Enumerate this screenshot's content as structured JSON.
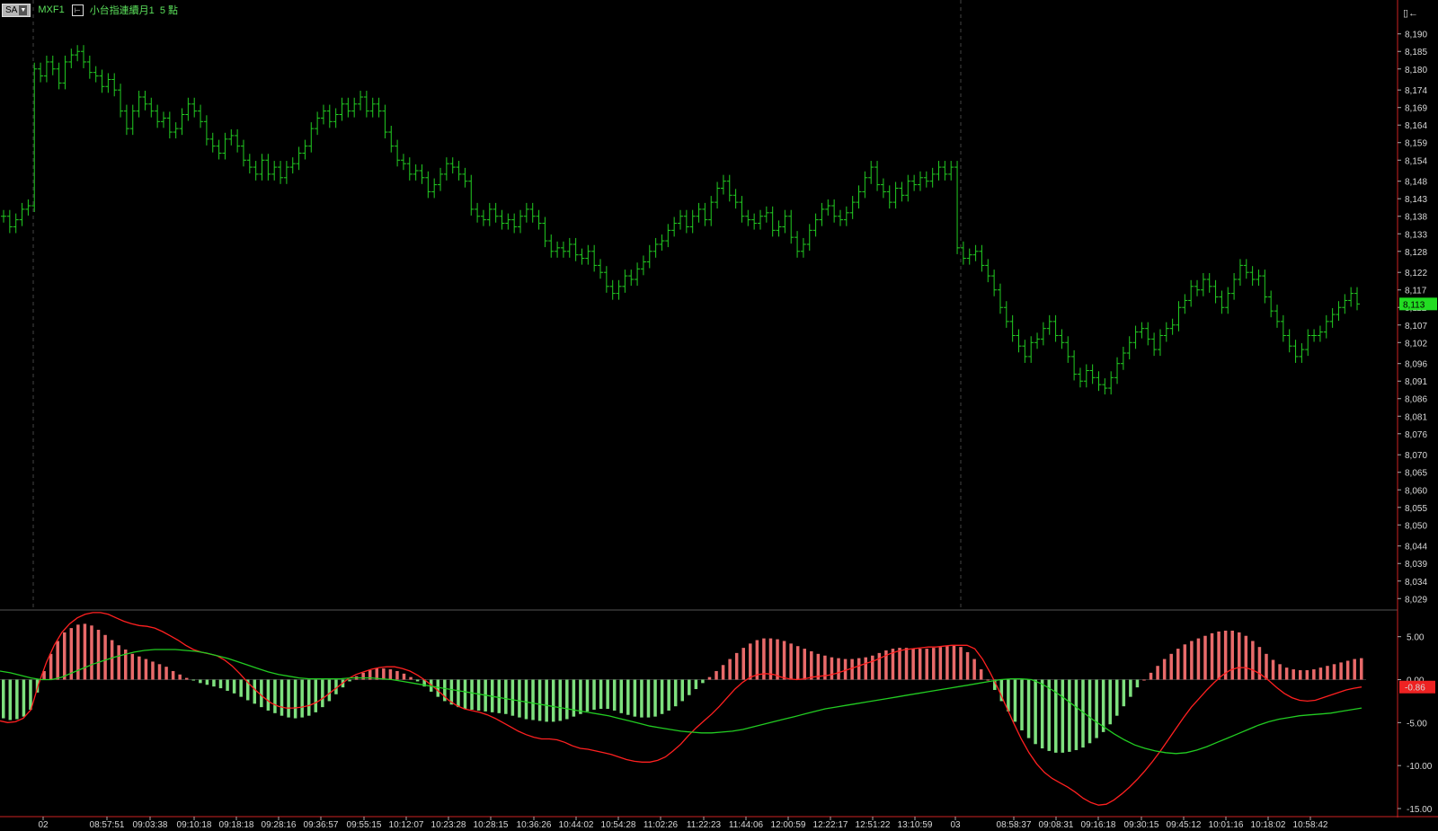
{
  "header": {
    "mode_label": "SA",
    "symbol": "MXF1",
    "chart_title": "小台指連續月1",
    "interval": "5 點"
  },
  "colors": {
    "bars": "#22cc22",
    "hist_up": "#e86a6a",
    "hist_down": "#7ee07e",
    "dif_line": "#ff2020",
    "signal_line": "#22cc22",
    "current_price_bg": "#22dd22",
    "current_osc_bg": "#ee2222",
    "panel_border": "#cc2222"
  },
  "icons": {
    "mode_dropdown": "chevron-down-icon",
    "toggle": "expand-icon",
    "pin": "pin-icon"
  },
  "chart_data": [
    {
      "type": "ohlc",
      "name": "price",
      "current_value": "8,113",
      "y_ticks": [
        "8,190",
        "8,185",
        "8,180",
        "8,174",
        "8,169",
        "8,164",
        "8,159",
        "8,154",
        "8,148",
        "8,143",
        "8,138",
        "8,133",
        "8,128",
        "8,122",
        "8,117",
        "8,112",
        "8,107",
        "8,102",
        "8,096",
        "8,091",
        "8,086",
        "8,081",
        "8,076",
        "8,070",
        "8,065",
        "8,060",
        "8,055",
        "8,050",
        "8,044",
        "8,039",
        "8,034",
        "8,029"
      ],
      "ylim": [
        8026,
        8193
      ],
      "close": [
        8138,
        8135,
        8137,
        8140,
        8141,
        8180,
        8178,
        8182,
        8180,
        8176,
        8182,
        8184,
        8185,
        8182,
        8179,
        8178,
        8175,
        8177,
        8174,
        8168,
        8163,
        8168,
        8172,
        8170,
        8168,
        8165,
        8166,
        8162,
        8163,
        8167,
        8170,
        8168,
        8165,
        8160,
        8158,
        8156,
        8160,
        8161,
        8158,
        8154,
        8152,
        8150,
        8154,
        8150,
        8152,
        8149,
        8152,
        8153,
        8156,
        8158,
        8163,
        8166,
        8168,
        8165,
        8167,
        8170,
        8168,
        8170,
        8172,
        8168,
        8170,
        8168,
        8162,
        8158,
        8154,
        8153,
        8150,
        8151,
        8149,
        8145,
        8147,
        8150,
        8153,
        8152,
        8150,
        8148,
        8140,
        8138,
        8137,
        8140,
        8138,
        8136,
        8137,
        8135,
        8138,
        8140,
        8138,
        8136,
        8131,
        8128,
        8129,
        8128,
        8130,
        8127,
        8126,
        8128,
        8124,
        8122,
        8118,
        8116,
        8118,
        8121,
        8120,
        8123,
        8125,
        8128,
        8130,
        8131,
        8134,
        8136,
        8138,
        8135,
        8138,
        8140,
        8137,
        8142,
        8146,
        8148,
        8144,
        8142,
        8138,
        8137,
        8136,
        8138,
        8139,
        8134,
        8135,
        8138,
        8132,
        8128,
        8130,
        8134,
        8137,
        8140,
        8141,
        8138,
        8137,
        8139,
        8142,
        8145,
        8149,
        8152,
        8147,
        8145,
        8142,
        8146,
        8144,
        8148,
        8147,
        8149,
        8148,
        8150,
        8152,
        8150,
        8152,
        8129,
        8126,
        8127,
        8128,
        8124,
        8121,
        8117,
        8112,
        8108,
        8104,
        8101,
        8098,
        8102,
        8103,
        8106,
        8108,
        8104,
        8102,
        8098,
        8093,
        8091,
        8094,
        8092,
        8090,
        8089,
        8092,
        8096,
        8099,
        8102,
        8105,
        8106,
        8103,
        8100,
        8104,
        8106,
        8107,
        8112,
        8114,
        8118,
        8117,
        8120,
        8118,
        8115,
        8112,
        8116,
        8120,
        8124,
        8122,
        8120,
        8121,
        8115,
        8111,
        8108,
        8104,
        8101,
        8098,
        8100,
        8104,
        8104,
        8105,
        8108,
        8110,
        8112,
        8114,
        8116,
        8113
      ]
    },
    {
      "type": "macd",
      "name": "oscillator",
      "current_value": "-0.86",
      "y_ticks": [
        "5.00",
        "0.00",
        "-5.00",
        "-10.00",
        "-15.00"
      ],
      "ylim": [
        -15,
        8
      ],
      "histogram": [
        -4.5,
        -4.7,
        -4.6,
        -4.3,
        -3.5,
        -1.5,
        1.0,
        3.0,
        4.5,
        5.5,
        6.0,
        6.4,
        6.5,
        6.3,
        5.8,
        5.2,
        4.6,
        4.0,
        3.5,
        3.0,
        2.7,
        2.4,
        2.1,
        1.8,
        1.5,
        1.0,
        0.6,
        0.2,
        -0.1,
        -0.4,
        -0.6,
        -0.8,
        -1.0,
        -1.3,
        -1.6,
        -2.0,
        -2.4,
        -2.8,
        -3.2,
        -3.6,
        -3.9,
        -4.2,
        -4.4,
        -4.5,
        -4.4,
        -4.2,
        -3.8,
        -3.2,
        -2.5,
        -1.7,
        -0.9,
        -0.2,
        0.4,
        0.8,
        1.1,
        1.3,
        1.3,
        1.2,
        1.0,
        0.7,
        0.3,
        -0.2,
        -0.8,
        -1.4,
        -2.0,
        -2.5,
        -2.9,
        -3.2,
        -3.4,
        -3.5,
        -3.6,
        -3.7,
        -3.8,
        -3.9,
        -4.0,
        -4.2,
        -4.4,
        -4.6,
        -4.7,
        -4.8,
        -4.9,
        -4.9,
        -4.8,
        -4.6,
        -4.3,
        -4.0,
        -3.7,
        -3.5,
        -3.4,
        -3.4,
        -3.6,
        -3.9,
        -4.1,
        -4.3,
        -4.4,
        -4.4,
        -4.3,
        -4.0,
        -3.6,
        -3.1,
        -2.5,
        -1.8,
        -1.1,
        -0.4,
        0.3,
        1.0,
        1.7,
        2.4,
        3.1,
        3.7,
        4.2,
        4.6,
        4.8,
        4.8,
        4.7,
        4.5,
        4.2,
        3.9,
        3.6,
        3.3,
        3.0,
        2.8,
        2.6,
        2.5,
        2.4,
        2.4,
        2.5,
        2.6,
        2.8,
        3.1,
        3.4,
        3.6,
        3.7,
        3.7,
        3.6,
        3.6,
        3.6,
        3.7,
        3.8,
        3.9,
        4.0,
        3.8,
        3.2,
        2.4,
        1.2,
        0.0,
        -1.2,
        -2.5,
        -3.7,
        -4.9,
        -5.9,
        -6.8,
        -7.5,
        -8.0,
        -8.3,
        -8.5,
        -8.5,
        -8.4,
        -8.2,
        -7.9,
        -7.4,
        -6.8,
        -6.1,
        -5.2,
        -4.2,
        -3.1,
        -2.0,
        -0.9,
        0.0,
        0.8,
        1.6,
        2.4,
        3.0,
        3.6,
        4.1,
        4.5,
        4.8,
        5.1,
        5.4,
        5.6,
        5.7,
        5.7,
        5.5,
        5.1,
        4.5,
        3.8,
        3.0,
        2.3,
        1.8,
        1.4,
        1.2,
        1.1,
        1.1,
        1.2,
        1.4,
        1.6,
        1.8,
        2.0,
        2.2,
        2.4,
        2.5
      ],
      "dif": [
        -4.8,
        -5.0,
        -4.9,
        -4.5,
        -3.5,
        -0.5,
        2.0,
        4.0,
        5.5,
        6.5,
        7.2,
        7.6,
        7.8,
        7.8,
        7.6,
        7.2,
        6.8,
        6.5,
        6.3,
        6.2,
        6.0,
        5.6,
        5.1,
        4.6,
        4.0,
        3.5,
        3.2,
        3.0,
        2.8,
        2.3,
        1.6,
        0.7,
        -0.3,
        -1.2,
        -2.0,
        -2.7,
        -3.1,
        -3.3,
        -3.3,
        -3.2,
        -3.0,
        -2.6,
        -2.0,
        -1.3,
        -0.6,
        0.1,
        0.6,
        0.9,
        1.2,
        1.4,
        1.5,
        1.5,
        1.3,
        1.0,
        0.5,
        -0.1,
        -0.8,
        -1.6,
        -2.4,
        -3.0,
        -3.4,
        -3.6,
        -3.8,
        -4.1,
        -4.5,
        -5.0,
        -5.5,
        -6.0,
        -6.4,
        -6.7,
        -6.9,
        -6.9,
        -7.0,
        -7.3,
        -7.7,
        -8.0,
        -8.1,
        -8.3,
        -8.5,
        -8.7,
        -9.0,
        -9.3,
        -9.5,
        -9.6,
        -9.6,
        -9.4,
        -9.0,
        -8.3,
        -7.5,
        -6.5,
        -5.6,
        -4.8,
        -4.0,
        -3.1,
        -2.1,
        -1.1,
        -0.3,
        0.3,
        0.6,
        0.7,
        0.6,
        0.3,
        0.1,
        0.0,
        0.1,
        0.3,
        0.4,
        0.5,
        0.7,
        1.0,
        1.3,
        1.6,
        1.9,
        2.2,
        2.6,
        3.0,
        3.3,
        3.5,
        3.6,
        3.7,
        3.8,
        3.8,
        3.9,
        4.0,
        4.0,
        4.0,
        3.6,
        2.4,
        0.8,
        -1.0,
        -3.0,
        -5.0,
        -6.9,
        -8.5,
        -9.8,
        -10.8,
        -11.5,
        -12.0,
        -12.5,
        -13.1,
        -13.8,
        -14.3,
        -14.6,
        -14.5,
        -14.0,
        -13.3,
        -12.5,
        -11.6,
        -10.6,
        -9.5,
        -8.3,
        -7.0,
        -5.7,
        -4.4,
        -3.2,
        -2.2,
        -1.2,
        -0.3,
        0.5,
        1.1,
        1.4,
        1.4,
        1.1,
        0.6,
        -0.1,
        -0.9,
        -1.6,
        -2.1,
        -2.4,
        -2.5,
        -2.4,
        -2.1,
        -1.8,
        -1.5,
        -1.2,
        -1.0,
        -0.86
      ],
      "signal": [
        1.0,
        0.8,
        0.5,
        0.2,
        0.0,
        0.0,
        0.3,
        0.8,
        1.3,
        1.8,
        2.2,
        2.6,
        2.9,
        3.2,
        3.4,
        3.5,
        3.5,
        3.5,
        3.4,
        3.3,
        3.1,
        2.8,
        2.5,
        2.1,
        1.7,
        1.3,
        0.9,
        0.6,
        0.4,
        0.2,
        0.1,
        0.1,
        0.1,
        0.1,
        0.2,
        0.2,
        0.2,
        0.1,
        0.0,
        -0.2,
        -0.4,
        -0.6,
        -0.8,
        -1.0,
        -1.2,
        -1.4,
        -1.6,
        -1.8,
        -2.0,
        -2.2,
        -2.4,
        -2.6,
        -2.8,
        -3.0,
        -3.2,
        -3.4,
        -3.6,
        -3.8,
        -4.0,
        -4.2,
        -4.5,
        -4.8,
        -5.1,
        -5.4,
        -5.6,
        -5.8,
        -6.0,
        -6.1,
        -6.2,
        -6.2,
        -6.1,
        -6.0,
        -5.8,
        -5.5,
        -5.2,
        -4.9,
        -4.6,
        -4.3,
        -4.0,
        -3.7,
        -3.4,
        -3.2,
        -3.0,
        -2.8,
        -2.6,
        -2.4,
        -2.2,
        -2.0,
        -1.8,
        -1.6,
        -1.4,
        -1.2,
        -1.0,
        -0.8,
        -0.6,
        -0.4,
        -0.2,
        0.0,
        0.1,
        0.1,
        0.0,
        -0.5,
        -1.2,
        -2.0,
        -2.9,
        -3.8,
        -4.7,
        -5.5,
        -6.3,
        -7.0,
        -7.6,
        -8.0,
        -8.3,
        -8.5,
        -8.6,
        -8.5,
        -8.2,
        -7.8,
        -7.3,
        -6.8,
        -6.3,
        -5.8,
        -5.3,
        -4.9,
        -4.6,
        -4.4,
        -4.2,
        -4.1,
        -4.0,
        -3.9,
        -3.7,
        -3.5,
        -3.3
      ]
    }
  ],
  "x_axis": {
    "labels": [
      "02",
      "08:57:51",
      "09:03:38",
      "09:10:18",
      "09:18:18",
      "09:28:16",
      "09:36:57",
      "09:55:15",
      "10:12:07",
      "10:23:28",
      "10:28:15",
      "10:36:26",
      "10:44:02",
      "10:54:28",
      "11:02:26",
      "11:22:23",
      "11:44:06",
      "12:00:59",
      "12:22:17",
      "12:51:22",
      "13:10:59",
      "03",
      "08:58:37",
      "09:08:31",
      "09:16:18",
      "09:30:15",
      "09:45:12",
      "10:01:16",
      "10:18:02",
      "10:58:42"
    ]
  }
}
